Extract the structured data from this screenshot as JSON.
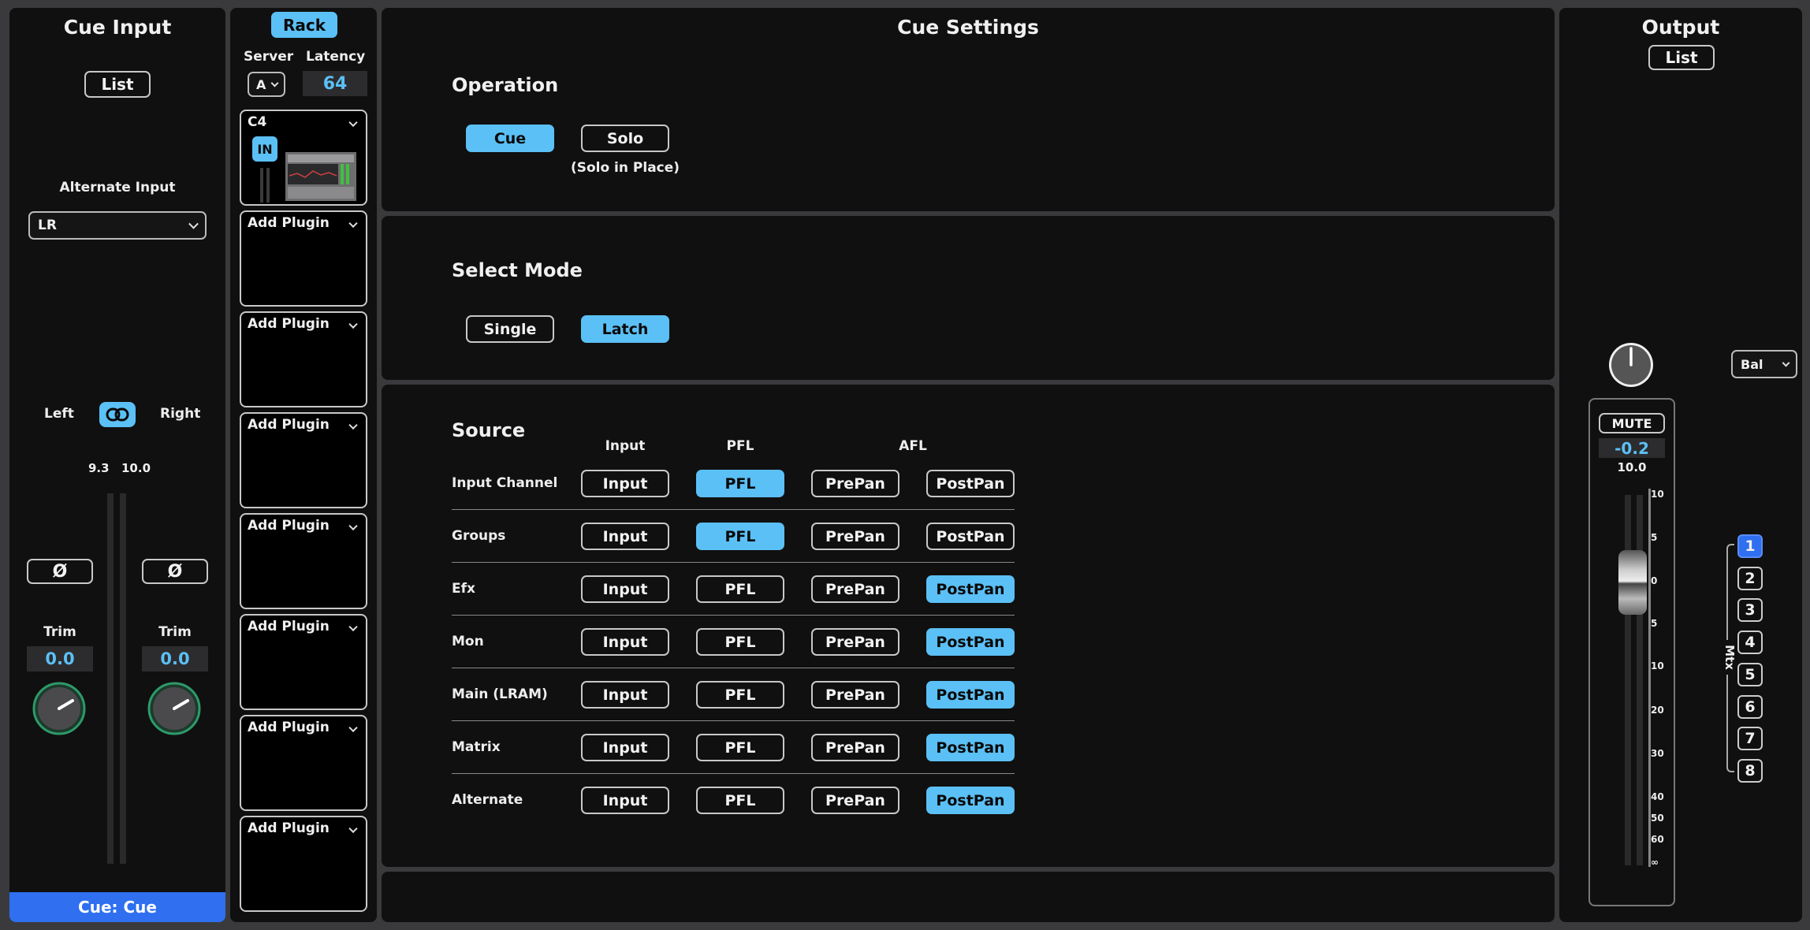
{
  "cue_input": {
    "title": "Cue Input",
    "list_label": "List",
    "alt_input_label": "Alternate Input",
    "alt_input_value": "LR",
    "left_label": "Left",
    "right_label": "Right",
    "left_meter_value": "9.3",
    "right_meter_value": "10.0",
    "phase_symbol": "Ø",
    "trim_label": "Trim",
    "left_trim": "0.0",
    "right_trim": "0.0",
    "footer": "Cue: Cue"
  },
  "rack": {
    "button": "Rack",
    "server_label": "Server",
    "server_value": "A",
    "latency_label": "Latency",
    "latency_value": "64",
    "first_plugin": {
      "name": "C4",
      "in_label": "IN"
    },
    "add_plugin_labels": [
      "Add Plugin",
      "Add Plugin",
      "Add Plugin",
      "Add Plugin",
      "Add Plugin",
      "Add Plugin",
      "Add Plugin"
    ]
  },
  "cue_settings": {
    "title": "Cue Settings",
    "operation": {
      "title": "Operation",
      "cue": "Cue",
      "solo": "Solo",
      "solo_note": "(Solo in Place)",
      "selected": "Cue"
    },
    "select_mode": {
      "title": "Select Mode",
      "single": "Single",
      "latch": "Latch",
      "selected": "Latch"
    },
    "source": {
      "title": "Source",
      "col_input": "Input",
      "col_pfl": "PFL",
      "col_afl": "AFL",
      "button_labels": [
        "Input",
        "PFL",
        "PrePan",
        "PostPan"
      ],
      "rows": [
        {
          "name": "Input Channel",
          "active": "PFL"
        },
        {
          "name": "Groups",
          "active": "PFL"
        },
        {
          "name": "Efx",
          "active": "PostPan"
        },
        {
          "name": "Mon",
          "active": "PostPan"
        },
        {
          "name": "Main (LRAM)",
          "active": "PostPan"
        },
        {
          "name": "Matrix",
          "active": "PostPan"
        },
        {
          "name": "Alternate",
          "active": "PostPan"
        }
      ]
    }
  },
  "output": {
    "title": "Output",
    "list_label": "List",
    "bal_label": "Bal",
    "mute_label": "MUTE",
    "fader_value": "-0.2",
    "meter_value": "10.0",
    "scale": [
      "10",
      "5",
      "0",
      "5",
      "10",
      "20",
      "30",
      "40",
      "50",
      "60",
      "∞"
    ],
    "mtx_label": "Mtx",
    "mtx_buttons": [
      "1",
      "2",
      "3",
      "4",
      "5",
      "6",
      "7",
      "8"
    ],
    "mtx_selected": "1"
  },
  "colors": {
    "accent": "#5bc0f5",
    "footer_blue": "#2f6ff0",
    "panel": "#101010",
    "background": "#3a3a3c"
  }
}
